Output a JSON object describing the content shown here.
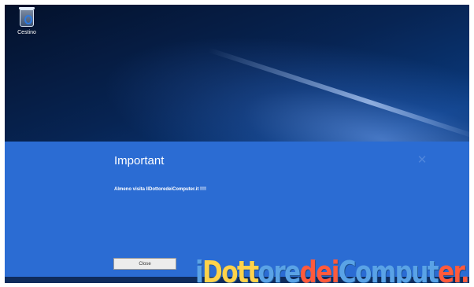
{
  "desktop": {
    "icon_label": "Cestino",
    "icon": "recycle-bin-icon"
  },
  "dialog": {
    "title": "Important",
    "message": "Almeno visita IlDottoredeiComputer.it !!!!",
    "close_button_label": "Close",
    "close_icon": "close-icon",
    "close_glyph": "✕"
  },
  "watermark": {
    "part1": "i",
    "part2": "Dott",
    "part3": "ore",
    "part4": "dei",
    "part5": "Comput",
    "part6": "er.i"
  },
  "colors": {
    "dialog_bg": "#2b6cd3",
    "desktop_bg": "#072453",
    "button_bg": "#ececec"
  }
}
